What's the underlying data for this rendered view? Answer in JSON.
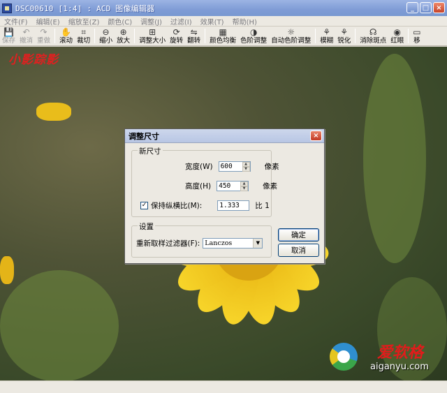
{
  "window": {
    "title": "DSC00610 [1:4] : ACD 图像编辑器"
  },
  "menu": [
    "文件(F)",
    "编辑(E)",
    "缩放至(Z)",
    "颜色(C)",
    "调整(J)",
    "过滤(I)",
    "效果(T)",
    "帮助(H)"
  ],
  "toolbar": [
    {
      "label": "保存",
      "icon": "save-icon",
      "glyph": "💾",
      "enabled": false
    },
    {
      "label": "撤消",
      "icon": "undo-icon",
      "glyph": "↶",
      "enabled": false
    },
    {
      "label": "重做",
      "icon": "redo-icon",
      "glyph": "↷",
      "enabled": false
    },
    {
      "label": "滚动",
      "icon": "hand-icon",
      "glyph": "✋",
      "enabled": true
    },
    {
      "label": "裁切",
      "icon": "crop-icon",
      "glyph": "⌗",
      "enabled": true
    },
    {
      "label": "缩小",
      "icon": "zoom-out-icon",
      "glyph": "⊖",
      "enabled": true
    },
    {
      "label": "放大",
      "icon": "zoom-in-icon",
      "glyph": "⊕",
      "enabled": true
    },
    {
      "label": "调整大小",
      "icon": "resize-icon",
      "glyph": "⊞",
      "enabled": true
    },
    {
      "label": "旋转",
      "icon": "rotate-icon",
      "glyph": "⟳",
      "enabled": true
    },
    {
      "label": "翻转",
      "icon": "flip-icon",
      "glyph": "⇋",
      "enabled": true
    },
    {
      "label": "颜色均衡",
      "icon": "color-balance-icon",
      "glyph": "▦",
      "enabled": true
    },
    {
      "label": "色阶调整",
      "icon": "levels-icon",
      "glyph": "◑",
      "enabled": true
    },
    {
      "label": "自动色阶调整",
      "icon": "auto-levels-icon",
      "glyph": "☼",
      "enabled": true
    },
    {
      "label": "模糊",
      "icon": "blur-icon",
      "glyph": "⚘",
      "enabled": true
    },
    {
      "label": "锐化",
      "icon": "sharpen-icon",
      "glyph": "⚘",
      "enabled": true
    },
    {
      "label": "消除斑点",
      "icon": "despeckle-icon",
      "glyph": "☊",
      "enabled": true
    },
    {
      "label": "红眼",
      "icon": "red-eye-icon",
      "glyph": "◉",
      "enabled": true
    },
    {
      "label": "移",
      "icon": "more-icon",
      "glyph": "▭",
      "enabled": true
    }
  ],
  "watermark": {
    "signature": "小影踪影",
    "brand": "爱软格",
    "url": "aiganyu.com"
  },
  "dialog": {
    "title": "调整尺寸",
    "new_size_group": "新尺寸",
    "width_label": "宽度(W)",
    "width_value": "600",
    "height_label": "高度(H)",
    "height_value": "450",
    "unit": "像素",
    "keep_ratio_label": "保持纵横比(M):",
    "keep_ratio_checked": true,
    "ratio_value": "1.333",
    "ratio_suffix": "比 1",
    "settings_group": "设置",
    "filter_label": "重新取样过滤器(F):",
    "filter_value": "Lanczos",
    "ok_label": "确定",
    "cancel_label": "取消"
  }
}
